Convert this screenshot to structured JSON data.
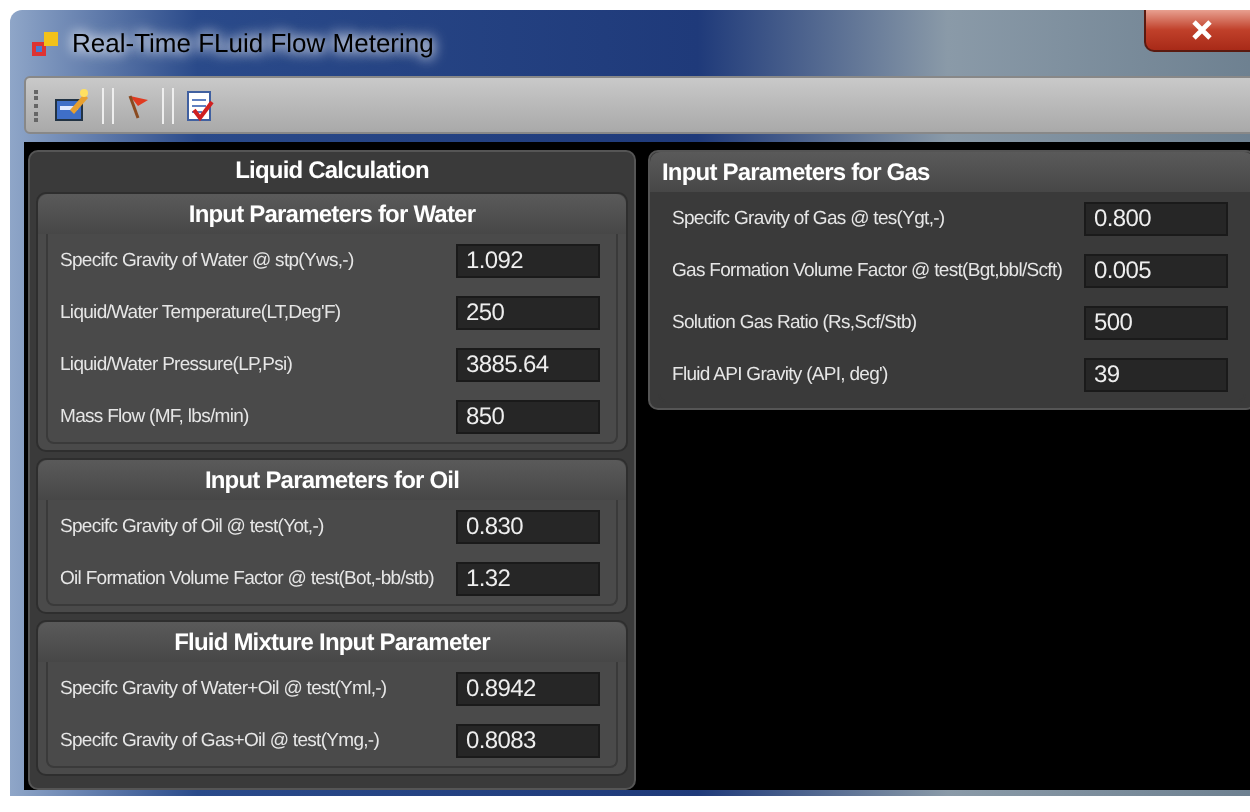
{
  "window": {
    "title": "Real-Time FLuid Flow Metering"
  },
  "liquid_calculation": {
    "title": "Liquid Calculation",
    "groups": [
      {
        "title": "Input Parameters for Water",
        "fields": [
          {
            "label": "Specifc Gravity of Water @ stp(Yws,-)",
            "value": "1.092"
          },
          {
            "label": "Liquid/Water Temperature(LT,Deg'F)",
            "value": "250"
          },
          {
            "label": "Liquid/Water Pressure(LP,Psi)",
            "value": "3885.64"
          },
          {
            "label": "Mass Flow (MF, lbs/min)",
            "value": "850"
          }
        ]
      },
      {
        "title": "Input Parameters for Oil",
        "fields": [
          {
            "label": "Specifc Gravity of Oil @ test(Yot,-)",
            "value": "0.830"
          },
          {
            "label": "Oil Formation Volume Factor @ test(Bot,-bb/stb)",
            "value": "1.32"
          }
        ]
      },
      {
        "title": "Fluid Mixture Input Parameter",
        "fields": [
          {
            "label": "Specifc Gravity of Water+Oil @ test(Yml,-)",
            "value": "0.8942"
          },
          {
            "label": "Specifc Gravity of Gas+Oil @ test(Ymg,-)",
            "value": "0.8083"
          }
        ]
      }
    ]
  },
  "gas_parameters": {
    "title": "Input Parameters for Gas",
    "fields": [
      {
        "label": "Specifc Gravity of Gas @ tes(Ygt,-)",
        "value": "0.800"
      },
      {
        "label": "Gas Formation Volume Factor @ test(Bgt,bbl/Scft)",
        "value": "0.005"
      },
      {
        "label": "Solution Gas Ratio (Rs,Scf/Stb)",
        "value": "500"
      },
      {
        "label": "Fluid API Gravity (API, deg')",
        "value": "39"
      }
    ]
  }
}
